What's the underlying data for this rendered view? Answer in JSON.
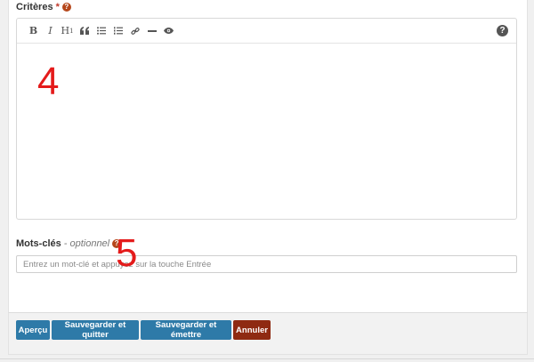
{
  "criteria": {
    "label": "Critères",
    "required_mark": "*",
    "help_glyph": "?",
    "toolbar": [
      {
        "name": "bold",
        "glyph": "B"
      },
      {
        "name": "italic",
        "glyph": "I"
      },
      {
        "name": "heading",
        "glyph": "H",
        "sub": "1"
      },
      {
        "name": "quote",
        "glyph": "❝"
      },
      {
        "name": "unordered-list",
        "glyph": "☰"
      },
      {
        "name": "ordered-list",
        "glyph": "☷"
      },
      {
        "name": "link",
        "glyph": "🔗"
      },
      {
        "name": "horizontal-rule",
        "glyph": "━"
      },
      {
        "name": "preview",
        "glyph": "👁"
      }
    ],
    "toolbar_help_glyph": "?"
  },
  "keywords": {
    "label": "Mots-clés",
    "optional_text": "- optionnel",
    "help_glyph": "?",
    "placeholder": "Entrez un mot-clé et appuyez sur la touche Entrée",
    "value": ""
  },
  "annotations": {
    "editor_marker": "4",
    "keywords_marker": "5"
  },
  "actions": {
    "preview": "Aperçu",
    "save_quit": "Sauvegarder et quitter",
    "save_issue": "Sauvegarder et émettre",
    "cancel": "Annuler"
  },
  "colors": {
    "primary_button": "#2e7aa8",
    "cancel_button": "#8f2a12",
    "help_badge": "#b5471b",
    "annotation": "#e41b1b"
  }
}
